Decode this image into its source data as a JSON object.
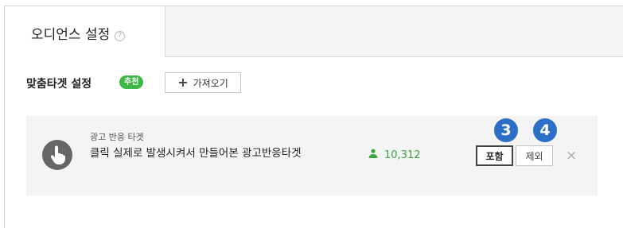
{
  "tabs": {
    "active_label": "오디언스 설정",
    "help_glyph": "?"
  },
  "section": {
    "title": "맞춤타겟 설정",
    "badge": "추천",
    "import_label": "가져오기"
  },
  "target": {
    "type_label": "광고 반응 타겟",
    "name": "클릭 실제로 발생시켜서 만들어본 광고반응타겟",
    "audience_count": "10,312",
    "include_label": "포함",
    "exclude_label": "제외",
    "remove_glyph": "×",
    "icon": "hand-pointer-icon"
  },
  "markers": {
    "step_include": "3",
    "step_exclude": "4"
  },
  "colors": {
    "accent_green": "#3db847",
    "marker_blue": "#2b6fc9"
  }
}
